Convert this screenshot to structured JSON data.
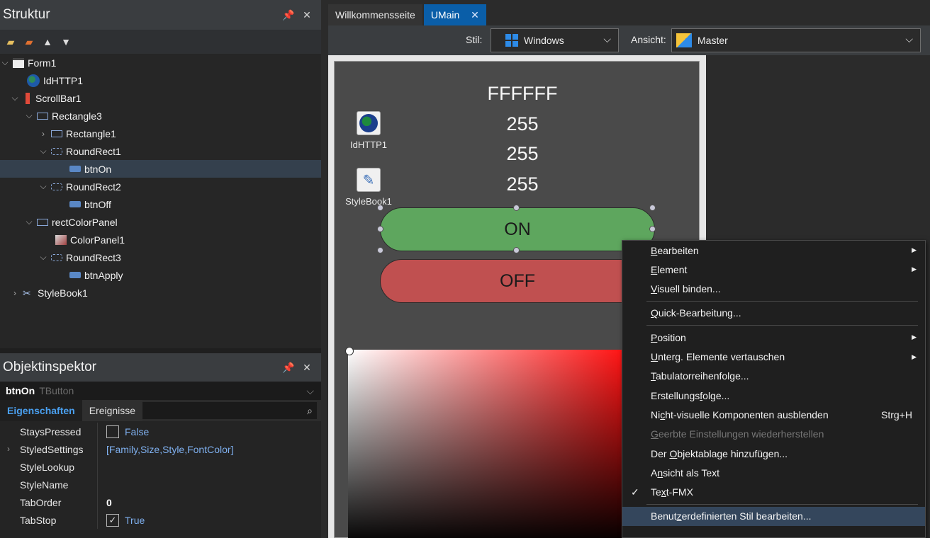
{
  "structure": {
    "title": "Struktur",
    "tree": [
      {
        "label": "Form1",
        "icon": "form-icon"
      },
      {
        "label": "IdHTTP1",
        "icon": "globe-icon"
      },
      {
        "label": "ScrollBar1",
        "icon": "scrollbar-icon"
      },
      {
        "label": "Rectangle3",
        "icon": "rectangle-icon"
      },
      {
        "label": "Rectangle1",
        "icon": "rectangle-icon"
      },
      {
        "label": "RoundRect1",
        "icon": "roundrect-icon"
      },
      {
        "label": "btnOn",
        "icon": "button-icon",
        "selected": true
      },
      {
        "label": "RoundRect2",
        "icon": "roundrect-icon"
      },
      {
        "label": "btnOff",
        "icon": "button-icon"
      },
      {
        "label": "rectColorPanel",
        "icon": "rectangle-icon"
      },
      {
        "label": "ColorPanel1",
        "icon": "colorpanel-icon"
      },
      {
        "label": "RoundRect3",
        "icon": "roundrect-icon"
      },
      {
        "label": "btnApply",
        "icon": "button-icon"
      },
      {
        "label": "StyleBook1",
        "icon": "stylebook-icon"
      }
    ]
  },
  "inspector": {
    "title": "Objektinspektor",
    "object_name": "btnOn",
    "object_class": "TButton",
    "tabs": [
      "Eigenschaften",
      "Ereignisse"
    ],
    "properties": [
      {
        "name": "StaysPressed",
        "value": "False",
        "checkbox": true,
        "checked": false
      },
      {
        "name": "StyledSettings",
        "value": "[Family,Size,Style,FontColor]",
        "expandable": true
      },
      {
        "name": "StyleLookup",
        "value": ""
      },
      {
        "name": "StyleName",
        "value": ""
      },
      {
        "name": "TabOrder",
        "value": "0"
      },
      {
        "name": "TabStop",
        "value": "True",
        "checkbox": true,
        "checked": true
      }
    ]
  },
  "doc_tabs": [
    {
      "label": "Willkommensseite",
      "active": false
    },
    {
      "label": "UMain",
      "active": true
    }
  ],
  "toolbar": {
    "style_label": "Stil:",
    "style_value": "Windows",
    "view_label": "Ansicht:",
    "view_value": "Master"
  },
  "form": {
    "hex_value": "FFFFFF",
    "rgb_values": [
      "255",
      "255",
      "255"
    ],
    "components": [
      {
        "label": "IdHTTP1",
        "icon": "globe-icon"
      },
      {
        "label": "StyleBook1",
        "icon": "stylebook-icon"
      }
    ],
    "on_button": "ON",
    "off_button": "OFF",
    "colors": {
      "on": "#5ea65e",
      "off": "#c05050"
    }
  },
  "context_menu": {
    "items": [
      {
        "label": "Bearbeiten",
        "ul": "B",
        "submenu": true
      },
      {
        "label": "Element",
        "ul": "E",
        "submenu": true
      },
      {
        "label": "Visuell binden...",
        "ul": "V"
      },
      {
        "sep": true
      },
      {
        "label": "Quick-Bearbeitung...",
        "ul": "Q"
      },
      {
        "sep": true
      },
      {
        "label": "Position",
        "ul": "P",
        "submenu": true
      },
      {
        "label": "Unterg. Elemente vertauschen",
        "ul": "U",
        "submenu": true
      },
      {
        "label": "Tabulatorreihenfolge...",
        "ul": "T"
      },
      {
        "label": "Erstellungsfolge...",
        "ul": "f"
      },
      {
        "label": "Nicht-visuelle Komponenten ausblenden",
        "ul": "c",
        "shortcut": "Strg+H"
      },
      {
        "label": "Geerbte Einstellungen wiederherstellen",
        "ul": "G",
        "disabled": true
      },
      {
        "label": "Der Objektablage hinzufügen...",
        "ul": "O"
      },
      {
        "label": "Ansicht als Text",
        "ul": "n"
      },
      {
        "label": "Text-FMX",
        "ul": "x",
        "checked": true
      },
      {
        "sep": true
      },
      {
        "label": "Benutzerdefinierten Stil bearbeiten...",
        "ul": "z",
        "highlighted": true
      }
    ]
  }
}
